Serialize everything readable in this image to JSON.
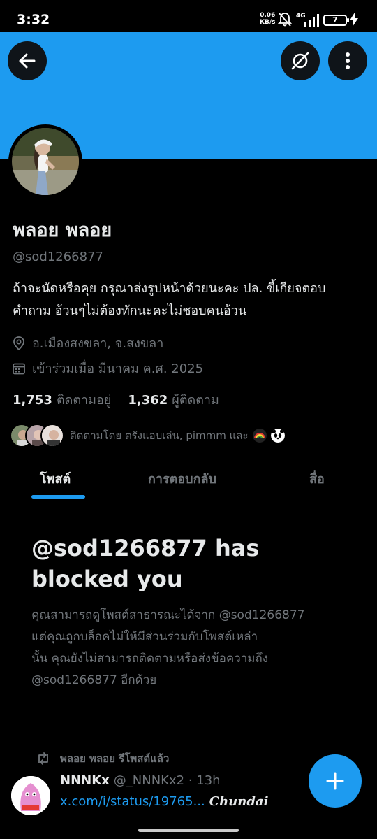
{
  "status_bar": {
    "time": "3:32",
    "speed_value": "0.06",
    "speed_unit": "KB/s",
    "network": "4G",
    "battery": "7"
  },
  "header": {
    "back_icon": "arrow-left-icon",
    "grok_icon": "grok-icon",
    "more_icon": "more-vertical-icon",
    "banner_color": "#1d9bf0"
  },
  "profile": {
    "name": "พลอย พลอย",
    "handle": "@sod1266877",
    "bio_line1": "ถ้าจะนัดหรือคุย กรุณาส่งรูปหน้าด้วยนะคะ ปล. ขี้เกียจตอบ",
    "bio_line2": "คำถาม อ้วนๆไม่ต้องทักนะคะไม่ชอบคนอ้วน",
    "location": "อ.เมืองสงขลา, จ.สงขลา",
    "joined": "เข้าร่วมเมื่อ มีนาคม ค.ศ. 2025",
    "following_count": "1,753",
    "following_label": "ติดตามอยู่",
    "followers_count": "1,362",
    "followers_label": "ผู้ติดตาม",
    "followed_by": "ติดตามโดย ตรังแอบเล่น, pimmm และ"
  },
  "tabs": [
    {
      "label": "โพสต์",
      "active": true
    },
    {
      "label": "การตอบกลับ",
      "active": false
    },
    {
      "label": "สื่อ",
      "active": false
    }
  ],
  "blocked": {
    "title": "@sod1266877 has blocked you",
    "line1": "คุณสามารถดูโพสต์สาธารณะได้จาก @sod1266877",
    "line2": "แต่คุณถูกบล็อคไม่ให้มีส่วนร่วมกับโพสต์เหล่า",
    "line3": "นั้น คุณยังไม่สามารถติดตามหรือส่งข้อความถึง",
    "line4": "@sod1266877 อีกด้วย"
  },
  "post": {
    "repost_label": "พลอย พลอย รีโพสต์แล้ว",
    "author_name": "NNNKx",
    "author_handle": "@_NNNKx2",
    "time": "· 13h",
    "link_text": "x.com/i/status/19765...",
    "extra_text": "Chundai"
  },
  "fab_icon": "plus-icon",
  "colors": {
    "accent": "#1d9bf0",
    "background": "#000000",
    "muted": "#71767b"
  }
}
